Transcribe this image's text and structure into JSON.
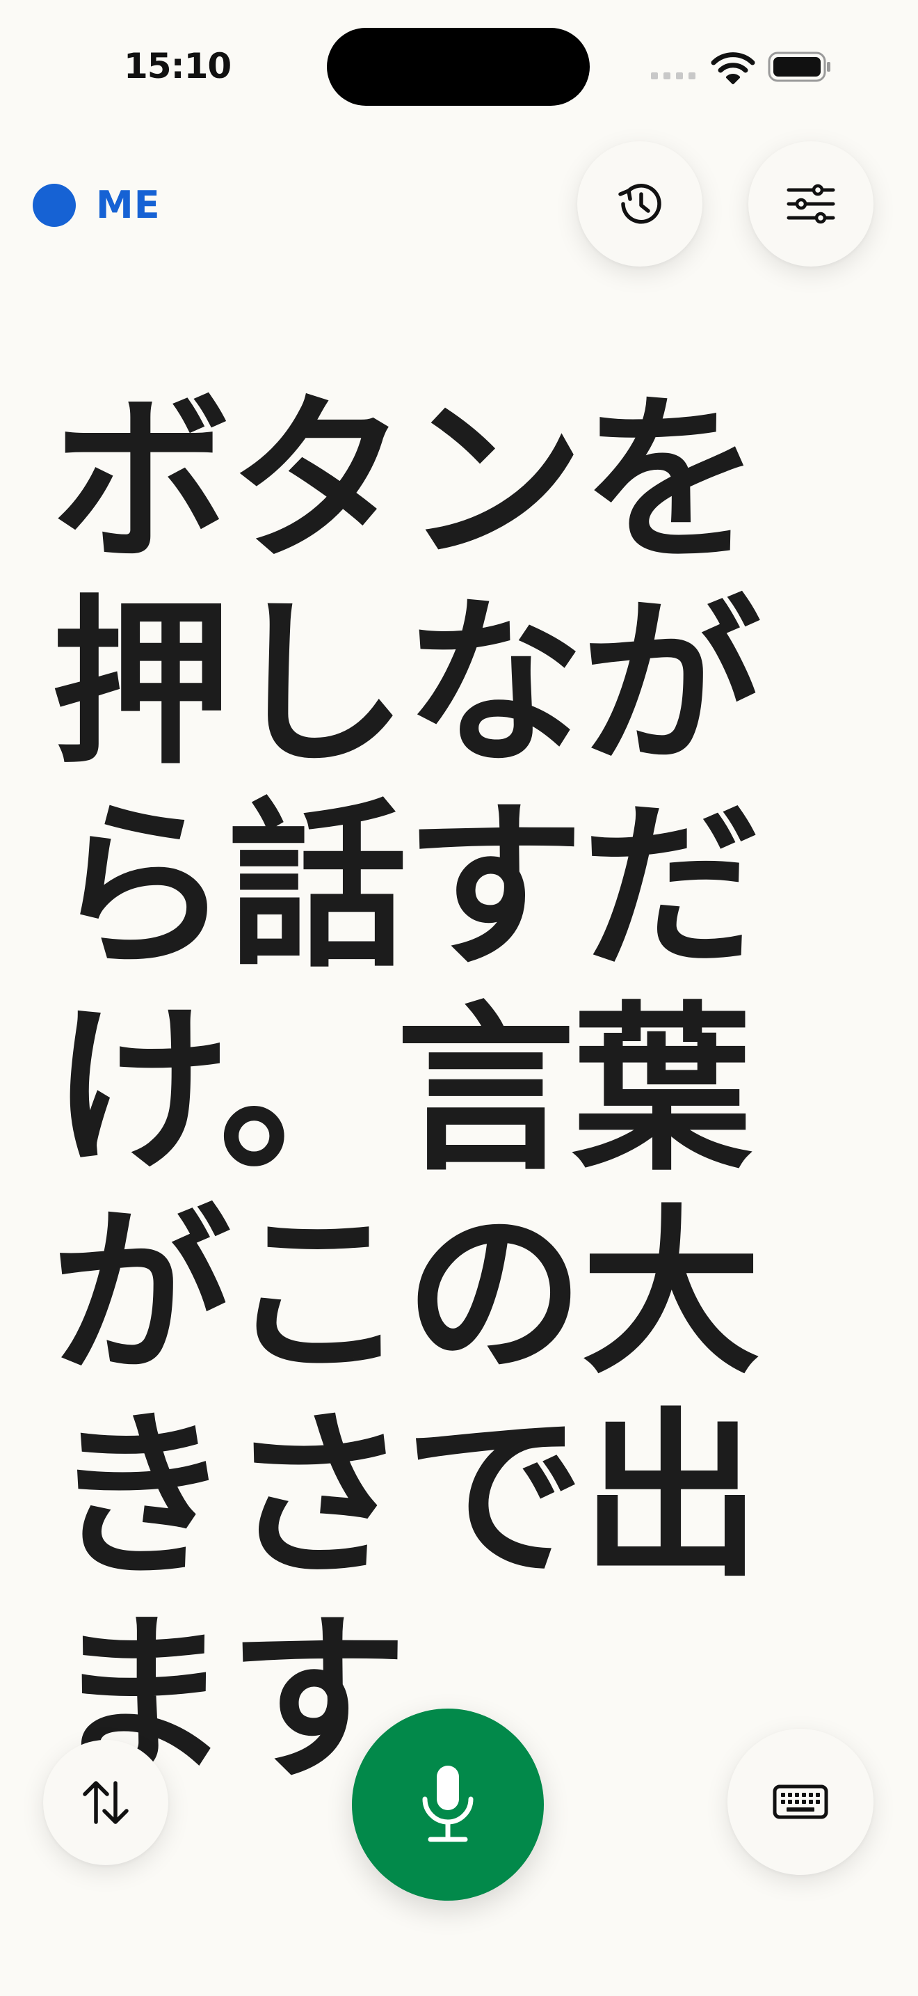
{
  "status_bar": {
    "time": "15:10"
  },
  "top_bar": {
    "speaker_label": "ME",
    "speaker_color": "#1662d4",
    "history_icon": "clock-history-icon",
    "settings_icon": "sliders-icon"
  },
  "main": {
    "transcript": "ボタンを押しながら話すだけ。言葉がこの大きさで出ます。"
  },
  "bottom_bar": {
    "swap_icon": "swap-arrows-icon",
    "mic_icon": "microphone-icon",
    "mic_color": "#02894a",
    "keyboard_icon": "keyboard-icon"
  }
}
